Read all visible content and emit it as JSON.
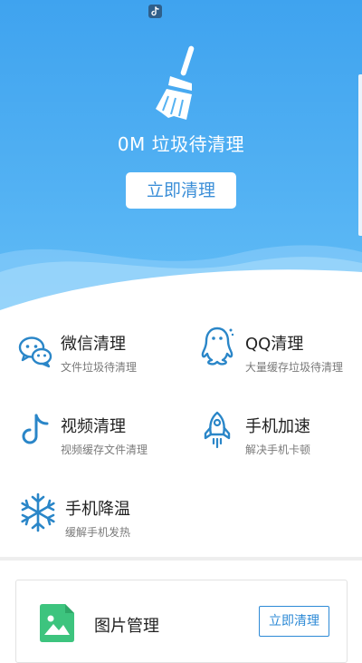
{
  "hero": {
    "junk_amount": "0M",
    "junk_label": "垃圾待清理",
    "title": "0M 垃圾待清理",
    "clean_button": "立即清理"
  },
  "features": [
    {
      "icon": "wechat-icon",
      "title": "微信清理",
      "subtitle": "文件垃圾待清理"
    },
    {
      "icon": "qq-icon",
      "title": "QQ清理",
      "subtitle": "大量缓存垃圾待清理"
    },
    {
      "icon": "tiktok-icon",
      "title": "视频清理",
      "subtitle": "视频缓存文件清理"
    },
    {
      "icon": "rocket-icon",
      "title": "手机加速",
      "subtitle": "解决手机卡顿"
    },
    {
      "icon": "snowflake-icon",
      "title": "手机降温",
      "subtitle": "缓解手机发热"
    }
  ],
  "card": {
    "icon": "picture-icon",
    "title": "图片管理",
    "button": "立即清理"
  },
  "colors": {
    "hero_top": "#3fa3ef",
    "hero_bottom": "#62bdf6",
    "icon_blue": "#2a86c8",
    "button_text": "#3c8fd8",
    "picture_green": "#3dc47e"
  }
}
